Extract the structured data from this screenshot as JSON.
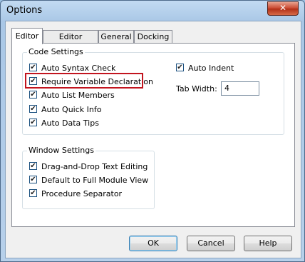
{
  "window": {
    "title": "Options",
    "close_glyph": "✕"
  },
  "tabs": [
    {
      "label": "Editor",
      "active": true
    },
    {
      "label": "Editor Format",
      "active": false
    },
    {
      "label": "General",
      "active": false
    },
    {
      "label": "Docking",
      "active": false
    }
  ],
  "code_settings": {
    "group_label": "Code Settings",
    "options": [
      {
        "label": "Auto Syntax Check",
        "checked": true
      },
      {
        "label": "Require Variable Declaration",
        "checked": true,
        "highlighted": true
      },
      {
        "label": "Auto List Members",
        "checked": true
      },
      {
        "label": "Auto Quick Info",
        "checked": true
      },
      {
        "label": "Auto Data Tips",
        "checked": true
      }
    ],
    "auto_indent": {
      "label": "Auto Indent",
      "checked": true
    },
    "tab_width": {
      "label": "Tab Width:",
      "value": "4"
    }
  },
  "window_settings": {
    "group_label": "Window Settings",
    "options": [
      {
        "label": "Drag-and-Drop Text Editing",
        "checked": true
      },
      {
        "label": "Default to Full Module View",
        "checked": true
      },
      {
        "label": "Procedure Separator",
        "checked": true
      }
    ]
  },
  "buttons": {
    "ok": "OK",
    "cancel": "Cancel",
    "help": "Help"
  },
  "colors": {
    "highlight": "#c2141e",
    "close_button": "#c8452c"
  },
  "check_glyph": "✔"
}
